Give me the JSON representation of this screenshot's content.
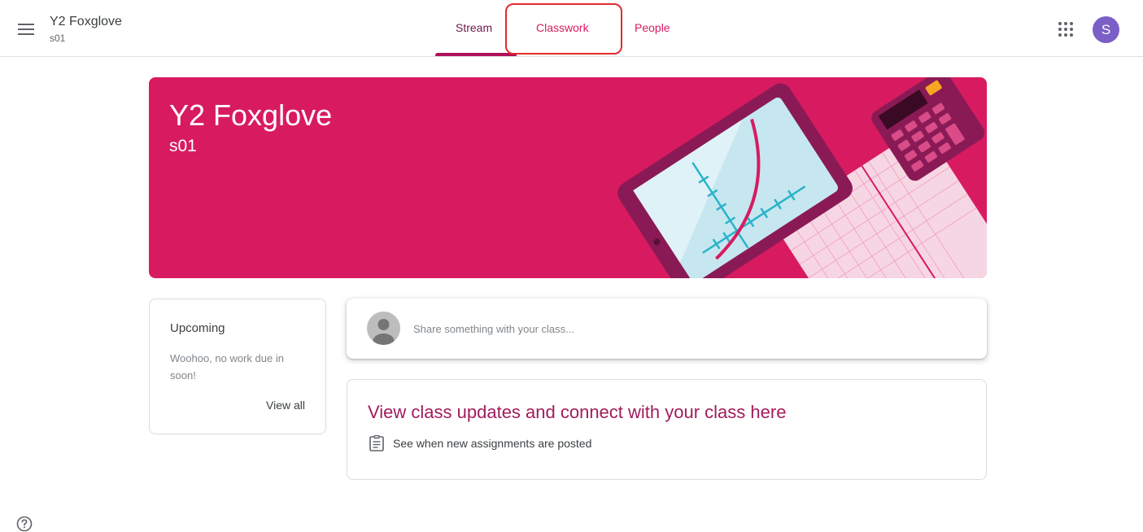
{
  "header": {
    "class_name": "Y2 Foxglove",
    "section": "s01",
    "tabs": [
      {
        "label": "Stream",
        "active": true
      },
      {
        "label": "Classwork",
        "active": false
      },
      {
        "label": "People",
        "active": false
      }
    ],
    "avatar_initial": "S",
    "icons": [
      "menu-icon",
      "apps-grid-icon"
    ]
  },
  "banner": {
    "title": "Y2 Foxglove",
    "section": "s01",
    "color": "#d81b60"
  },
  "upcoming": {
    "title": "Upcoming",
    "message": "Woohoo, no work due in soon!",
    "view_all_label": "View all"
  },
  "share": {
    "placeholder": "Share something with your class..."
  },
  "updates": {
    "title": "View class updates and connect with your class here",
    "item_text": "See when new assignments are posted",
    "item_icon": "assignment-icon"
  },
  "colors": {
    "accent": "#d81b60",
    "tab_active": "#6d1a4a",
    "avatar": "#7b5fc7",
    "annotation": "#e02b2b"
  }
}
